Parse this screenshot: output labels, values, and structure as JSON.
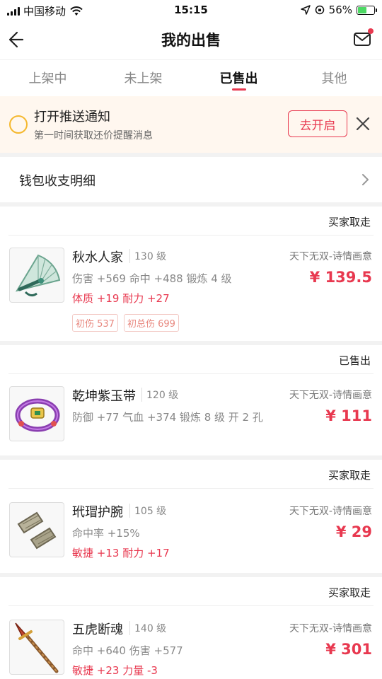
{
  "status_bar": {
    "carrier": "中国移动",
    "time": "15:15",
    "battery": "56%",
    "battery_level": 0.56
  },
  "nav": {
    "title": "我的出售"
  },
  "tabs": [
    {
      "label": "上架中",
      "active": false
    },
    {
      "label": "未上架",
      "active": false
    },
    {
      "label": "已售出",
      "active": true
    },
    {
      "label": "其他",
      "active": false
    }
  ],
  "notice": {
    "title": "打开推送通知",
    "subtitle": "第一时间获取还价提醒消息",
    "button": "去开启"
  },
  "wallet": {
    "label": "钱包收支明细"
  },
  "items": [
    {
      "status": "买家取走",
      "name": "秋水人家",
      "level": "130 级",
      "server": "天下无双-诗情画意",
      "stats": "伤害 +569 命中 +488 锻炼 4 级",
      "bonus": "体质 +19 耐力 +27",
      "price": "¥ 139.5",
      "tags": [
        "初伤 537",
        "初总伤 699"
      ],
      "icon": "fan-weapon-icon"
    },
    {
      "status": "已售出",
      "name": "乾坤紫玉带",
      "level": "120 级",
      "server": "天下无双-诗情画意",
      "stats": "防御 +77 气血 +374 锻炼 8 级 开 2 孔",
      "bonus": "",
      "price": "¥ 111",
      "tags": [],
      "icon": "jade-belt-icon"
    },
    {
      "status": "买家取走",
      "name": "玳瑁护腕",
      "level": "105 级",
      "server": "天下无双-诗情画意",
      "stats": "命中率 +15%",
      "bonus": "敏捷 +13 耐力 +17",
      "price": "¥ 29",
      "tags": [],
      "icon": "bracer-icon"
    },
    {
      "status": "买家取走",
      "name": "五虎断魂",
      "level": "140 级",
      "server": "天下无双-诗情画意",
      "stats": "命中 +640 伤害 +577",
      "bonus": "敏捷 +23 力量 -3",
      "price": "¥ 301",
      "tags": [],
      "icon": "spear-weapon-icon"
    }
  ],
  "colors": {
    "accent": "#e8384f",
    "notice_bg": "#fff7ef",
    "notice_icon": "#f5b82e"
  }
}
